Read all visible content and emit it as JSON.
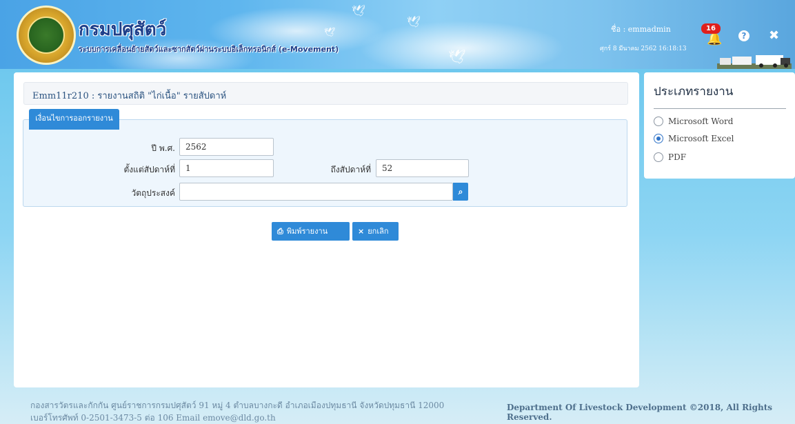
{
  "header": {
    "brand_title": "กรมปศุสัตว์",
    "brand_subtitle": "ระบบการเคลื่อนย้ายสัตว์และซากสัตว์ผ่านระบบอิเล็กทรอนิกส์ (e-Movement)",
    "user_label": "ชื่อ : emmadmin",
    "datetime": "ศุกร์ 8 มีนาคม 2562 16:18:13",
    "notification_count": "16",
    "help_icon": "question-circle-icon",
    "close_icon": "close-icon",
    "bell_icon": "bell-icon"
  },
  "main": {
    "page_title": "Emm11r210 : รายงานสถิติ \"ไก่เนื้อ\" รายสัปดาห์",
    "tab_label": "เงื่อนไขการออกรายงาน",
    "fields": {
      "year_label": "ปี พ.ศ.",
      "year_value": "2562",
      "from_week_label": "ตั้งแต่สัปดาห์ที่",
      "from_week_value": "1",
      "to_week_label": "ถึงสัปดาห์ที่",
      "to_week_value": "52",
      "purpose_label": "วัตถุประสงค์",
      "purpose_value": ""
    },
    "buttons": {
      "print_label": "พิมพ์รายงาน",
      "cancel_label": "ยกเลิก"
    }
  },
  "side": {
    "title": "ประเภทรายงาน",
    "options": [
      {
        "label": "Microsoft Word",
        "selected": false
      },
      {
        "label": "Microsoft Excel",
        "selected": true
      },
      {
        "label": "PDF",
        "selected": false
      }
    ]
  },
  "footer": {
    "address_line1": "กองสารวัตรและกักกัน ศูนย์ราชการกรมปศุสัตว์ 91 หมู่ 4 ตำบลบางกะดี อำเภอเมืองปทุมธานี จังหวัดปทุมธานี 12000",
    "address_line2": "เบอร์โทรศัพท์ 0-2501-3473-5 ต่อ 106 Email emove@dld.go.th",
    "copyright": "Department Of Livestock Development ©2018, All Rights Reserved."
  },
  "colors": {
    "accent": "#2f8ad8",
    "badge": "#e0201c",
    "title_text": "#2b5380"
  }
}
